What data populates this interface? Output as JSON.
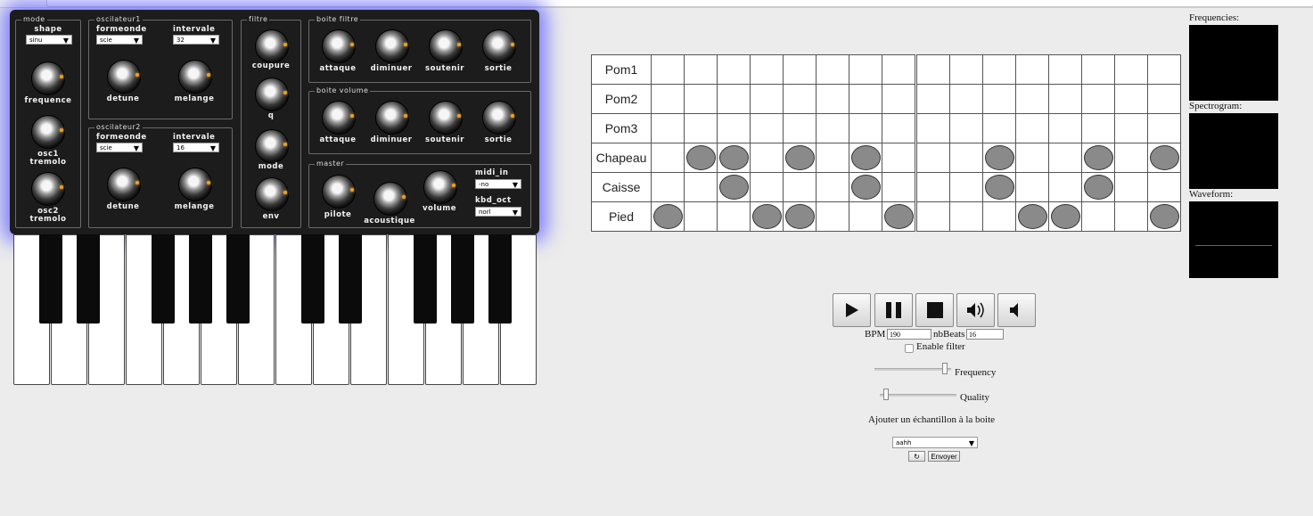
{
  "synth": {
    "mode": {
      "title": "mode",
      "shape_label": "shape",
      "shape_value": "sinu",
      "frequence": "frequence",
      "osc1_tremolo": [
        "osc1",
        "tremolo"
      ],
      "osc2_tremolo": [
        "osc2",
        "tremolo"
      ]
    },
    "osc1": {
      "title": "oscilateur1",
      "formeonde_label": "formeonde",
      "formeonde_value": "scie",
      "intervale_label": "intervale",
      "intervale_value": "32",
      "detune": "detune",
      "melange": "melange"
    },
    "osc2": {
      "title": "oscilateur2",
      "formeonde_label": "formeonde",
      "formeonde_value": "scie",
      "intervale_label": "intervale",
      "intervale_value": "16",
      "detune": "detune",
      "melange": "melange"
    },
    "filtre": {
      "title": "filtre",
      "coupure": "coupure",
      "q": "q",
      "mode": "mode",
      "env": "env"
    },
    "boite_filtre": {
      "title": "boite filtre",
      "labels": [
        "attaque",
        "diminuer",
        "soutenir",
        "sortie"
      ]
    },
    "boite_volume": {
      "title": "boite volume",
      "labels": [
        "attaque",
        "diminuer",
        "soutenir",
        "sortie"
      ]
    },
    "master": {
      "title": "master",
      "pilote": "pilote",
      "acoustique": "acoustique",
      "volume": "volume",
      "midi_in_label": "midi_in",
      "midi_in_value": "-no",
      "kbd_oct_label": "kbd_oct",
      "kbd_oct_value": "norl"
    }
  },
  "sequencer": {
    "rows": [
      {
        "name": "Pom1",
        "steps": [
          0,
          0,
          0,
          0,
          0,
          0,
          0,
          0,
          0,
          0,
          0,
          0,
          0,
          0,
          0,
          0
        ]
      },
      {
        "name": "Pom2",
        "steps": [
          0,
          0,
          0,
          0,
          0,
          0,
          0,
          0,
          0,
          0,
          0,
          0,
          0,
          0,
          0,
          0
        ]
      },
      {
        "name": "Pom3",
        "steps": [
          0,
          0,
          0,
          0,
          0,
          0,
          0,
          0,
          0,
          0,
          0,
          0,
          0,
          0,
          0,
          0
        ]
      },
      {
        "name": "Chapeau",
        "steps": [
          0,
          1,
          1,
          0,
          1,
          0,
          1,
          0,
          0,
          0,
          1,
          0,
          0,
          1,
          0,
          1
        ]
      },
      {
        "name": "Caisse",
        "steps": [
          0,
          0,
          1,
          0,
          0,
          0,
          1,
          0,
          0,
          0,
          1,
          0,
          0,
          1,
          0,
          0
        ]
      },
      {
        "name": "Pied",
        "steps": [
          1,
          0,
          0,
          1,
          1,
          0,
          0,
          1,
          0,
          0,
          0,
          1,
          1,
          0,
          0,
          1
        ]
      }
    ]
  },
  "visualizers": {
    "frequencies": "Frequencies:",
    "spectrogram": "Spectrogram:",
    "waveform": "Waveform:"
  },
  "transport": {
    "icons": [
      "play-icon",
      "pause-icon",
      "stop-icon",
      "volume-icon",
      "mute-icon"
    ],
    "bpm_label": "BPM",
    "bpm_value": "190",
    "nbbeats_label": "nbBeats",
    "nbbeats_value": "16",
    "enable_filter": "Enable filter",
    "frequency": "Frequency",
    "quality": "Quality",
    "frequency_level": 0.95,
    "quality_level": 0.05,
    "add_sample": "Ajouter un échantillon à la boite",
    "sample_value": "aahh",
    "refresh_label": "↻",
    "send_label": "Envoyer"
  }
}
